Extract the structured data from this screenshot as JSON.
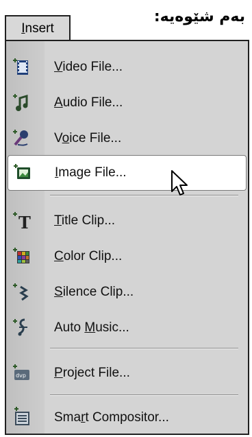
{
  "caption": "بەم شێوەیە:",
  "menu_button": {
    "pre": "",
    "u": "I",
    "post": "nsert"
  },
  "items": [
    {
      "pre": "",
      "u": "V",
      "post": "ideo File...",
      "icon": "video-file-icon"
    },
    {
      "pre": "",
      "u": "A",
      "post": "udio File...",
      "icon": "audio-file-icon"
    },
    {
      "pre": "V",
      "u": "o",
      "post": "ice File...",
      "icon": "voice-file-icon"
    },
    {
      "pre": "",
      "u": "I",
      "post": "mage File...",
      "icon": "image-file-icon"
    },
    {
      "pre": "",
      "u": "T",
      "post": "itle Clip...",
      "icon": "title-clip-icon"
    },
    {
      "pre": "",
      "u": "C",
      "post": "olor Clip...",
      "icon": "color-clip-icon"
    },
    {
      "pre": "",
      "u": "S",
      "post": "ilence Clip...",
      "icon": "silence-clip-icon"
    },
    {
      "pre": "Auto ",
      "u": "M",
      "post": "usic...",
      "icon": "auto-music-icon"
    },
    {
      "pre": "",
      "u": "P",
      "post": "roject File...",
      "icon": "project-file-icon",
      "badge": "dvp"
    },
    {
      "pre": "Sma",
      "u": "r",
      "post": "t Compositor...",
      "icon": "smart-compositor-icon"
    }
  ]
}
